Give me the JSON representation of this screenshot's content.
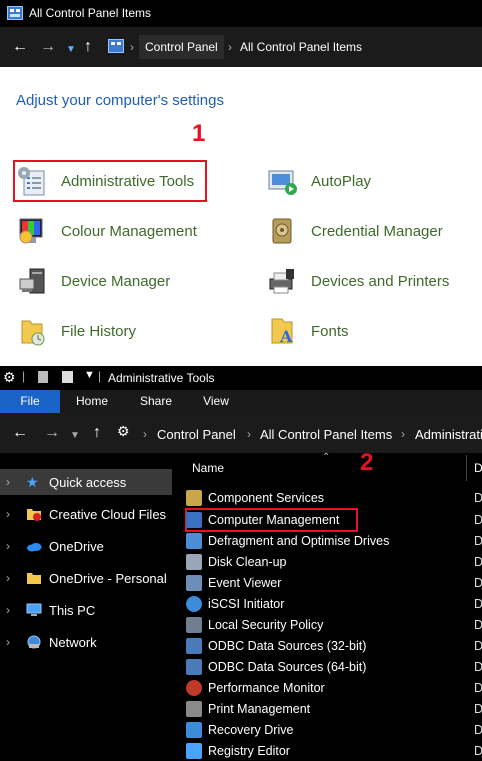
{
  "top_window": {
    "title": "All Control Panel Items",
    "breadcrumb": [
      "Control Panel",
      "All Control Panel Items"
    ],
    "heading": "Adjust your computer's settings",
    "step_marker": "1",
    "items": [
      {
        "label": "Administrative Tools",
        "icon": "administrative-tools-icon"
      },
      {
        "label": "AutoPlay",
        "icon": "autoplay-icon"
      },
      {
        "label": "Colour Management",
        "icon": "colour-management-icon"
      },
      {
        "label": "Credential Manager",
        "icon": "credential-manager-icon"
      },
      {
        "label": "Device Manager",
        "icon": "device-manager-icon"
      },
      {
        "label": "Devices and Printers",
        "icon": "devices-printers-icon"
      },
      {
        "label": "File History",
        "icon": "file-history-icon"
      },
      {
        "label": "Fonts",
        "icon": "fonts-icon"
      }
    ]
  },
  "bottom_window": {
    "title": "Administrative Tools",
    "tabs": [
      "File",
      "Home",
      "Share",
      "View"
    ],
    "breadcrumb": [
      "Control Panel",
      "All Control Panel Items",
      "Administrati"
    ],
    "column_name": "Name",
    "column_d": "D",
    "step_marker": "2",
    "sidebar": [
      {
        "label": "Quick access",
        "icon": "star-icon"
      },
      {
        "label": "Creative Cloud Files",
        "icon": "creative-cloud-icon"
      },
      {
        "label": "OneDrive",
        "icon": "onedrive-icon"
      },
      {
        "label": "OneDrive - Personal",
        "icon": "folder-icon"
      },
      {
        "label": "This PC",
        "icon": "pc-icon"
      },
      {
        "label": "Network",
        "icon": "network-icon"
      }
    ],
    "files": [
      {
        "label": "Component Services",
        "col": "D"
      },
      {
        "label": "Computer Management",
        "col": "D"
      },
      {
        "label": "Defragment and Optimise Drives",
        "col": "D"
      },
      {
        "label": "Disk Clean-up",
        "col": "D"
      },
      {
        "label": "Event Viewer",
        "col": "D"
      },
      {
        "label": "iSCSI Initiator",
        "col": "D"
      },
      {
        "label": "Local Security Policy",
        "col": "D"
      },
      {
        "label": "ODBC Data Sources (32-bit)",
        "col": "D"
      },
      {
        "label": "ODBC Data Sources (64-bit)",
        "col": "D"
      },
      {
        "label": "Performance Monitor",
        "col": "D"
      },
      {
        "label": "Print Management",
        "col": "D"
      },
      {
        "label": "Recovery Drive",
        "col": "D"
      },
      {
        "label": "Registry Editor",
        "col": "D"
      }
    ]
  },
  "colors": {
    "link_green": "#3e6b2a",
    "heading_blue": "#1e5db8",
    "marker_red": "#e81123",
    "file_tab_blue": "#1a64c7"
  }
}
